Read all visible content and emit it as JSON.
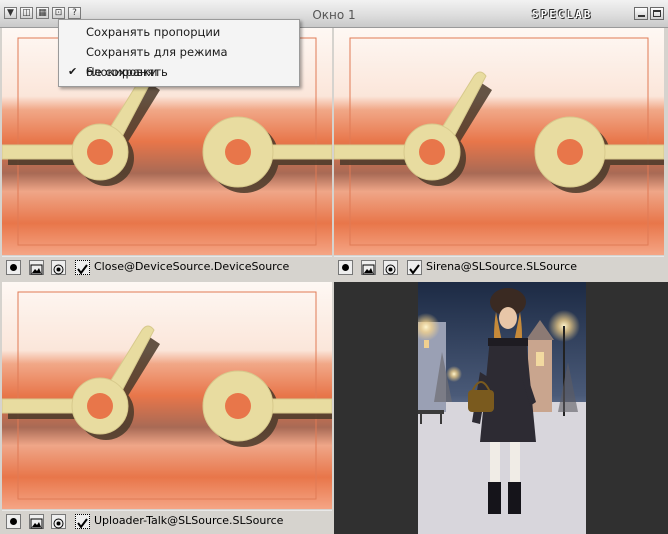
{
  "window": {
    "title": "Окно 1",
    "brand": "SPECLAB"
  },
  "menu": {
    "items": [
      {
        "label": "Сохранять пропорции",
        "checked": false
      },
      {
        "label": "Сохранять для режима блокировки",
        "checked": false
      },
      {
        "label": "Не сохранять",
        "checked": true
      }
    ]
  },
  "panels": [
    {
      "source": "Close@DeviceSource.DeviceSource",
      "enabled": true
    },
    {
      "source": "Sirena@SLSource.SLSource",
      "enabled": true
    },
    {
      "source": "Uploader-Talk@SLSource.SLSource",
      "enabled": true
    }
  ],
  "icons": {
    "record": "record-icon",
    "image": "image-icon",
    "target": "target-icon",
    "check": "checkbox-icon"
  },
  "colors": {
    "accent": "#e8764a",
    "switch": "#e8dca0"
  }
}
